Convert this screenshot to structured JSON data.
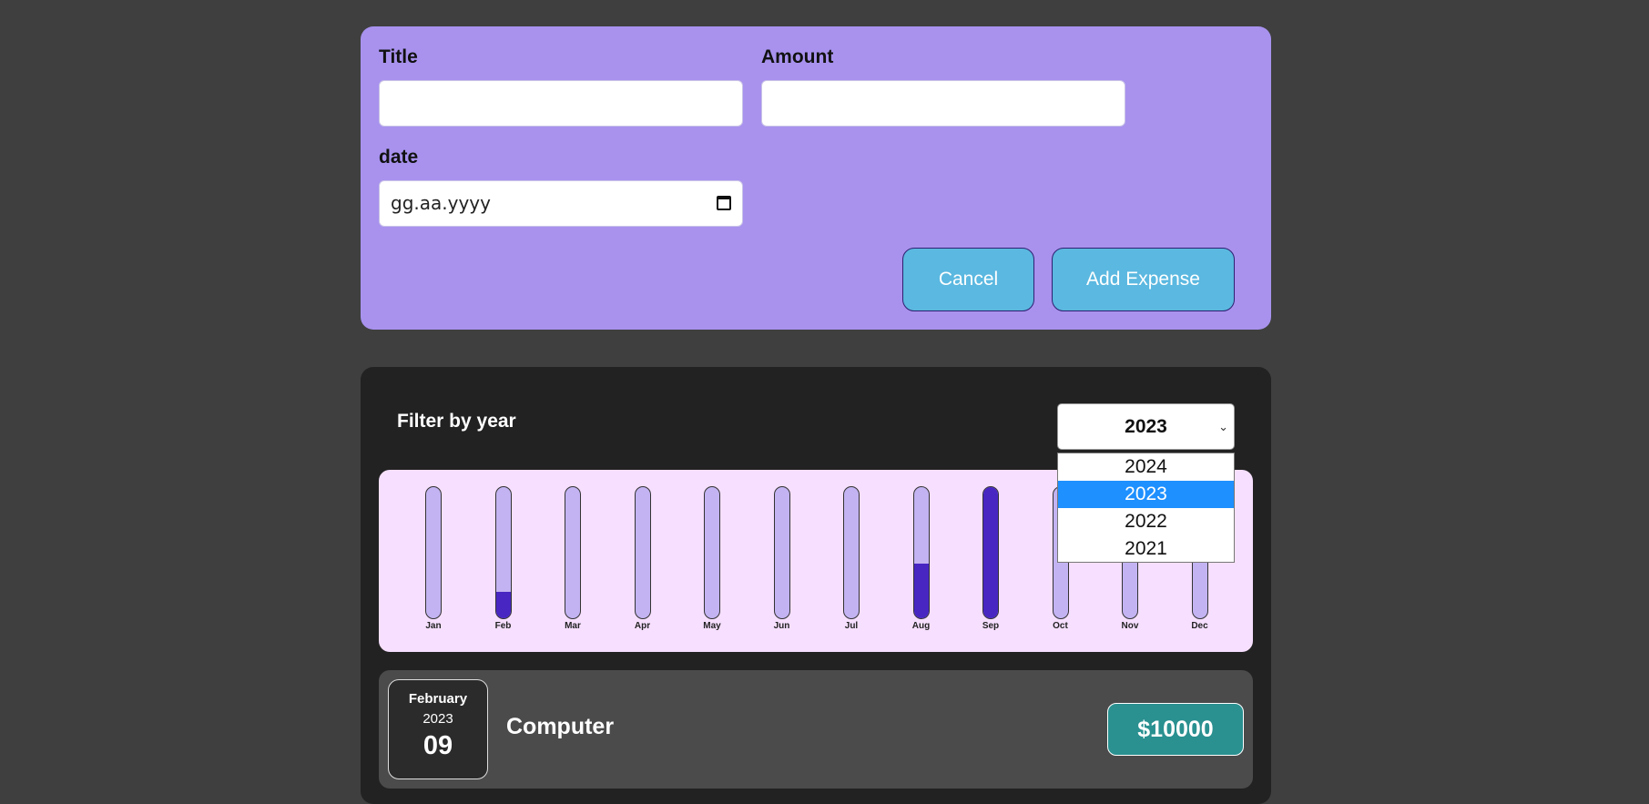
{
  "form": {
    "title_label": "Title",
    "title_value": "",
    "amount_label": "Amount",
    "amount_value": "",
    "date_label": "date",
    "date_placeholder": "gg.aa.yyyy",
    "cancel_label": "Cancel",
    "add_label": "Add Expense",
    "accent_color": "#a892ee",
    "button_color": "#5bb8e0"
  },
  "filter": {
    "label": "Filter by year",
    "selected_year": "2023",
    "options": [
      "2024",
      "2023",
      "2022",
      "2021"
    ],
    "highlighted_option": "2023"
  },
  "chart_data": {
    "type": "bar",
    "categories": [
      "Jan",
      "Feb",
      "Mar",
      "Apr",
      "May",
      "Jun",
      "Jul",
      "Aug",
      "Sep",
      "Oct",
      "Nov",
      "Dec"
    ],
    "values": [
      0,
      0.2,
      0,
      0,
      0,
      0,
      0,
      0.42,
      1.0,
      0,
      0,
      0
    ],
    "fill_color": "#4826c2",
    "track_color": "#c3b3f2"
  },
  "expenses": [
    {
      "month": "February",
      "year": "2023",
      "day": "09",
      "title": "Computer",
      "amount": "$10000"
    }
  ]
}
